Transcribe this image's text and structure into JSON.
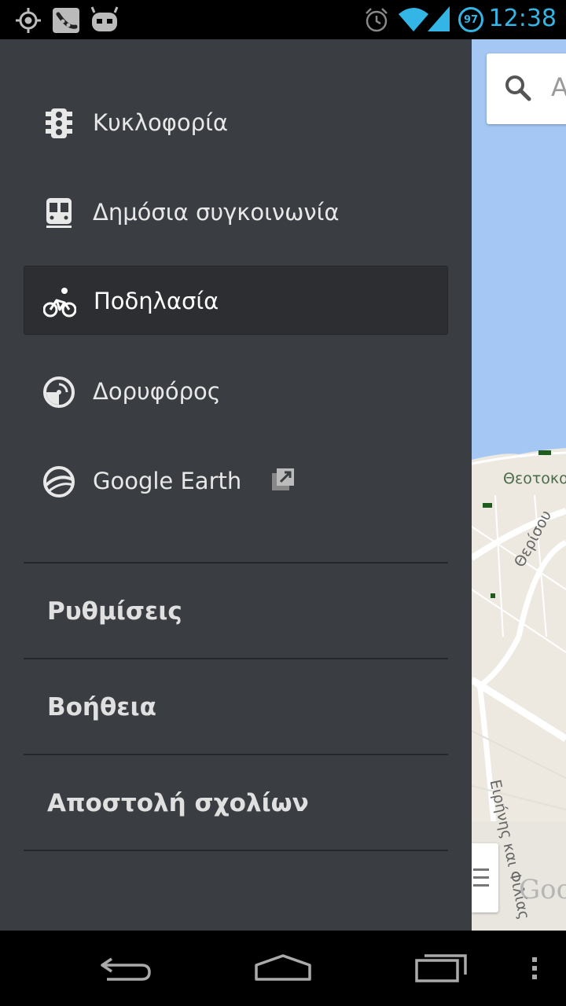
{
  "status_bar": {
    "time": "12:38",
    "battery_level": "97",
    "icons": [
      "location-icon",
      "pea-icon",
      "android-icon",
      "alarm-icon",
      "wifi-icon",
      "signal-icon",
      "battery-icon"
    ]
  },
  "map": {
    "search_hint": "A",
    "labels": {
      "theotokou": "Θεοτοκο",
      "therisou": "Θερίσου",
      "eirinis": "Ειρήνης και Φιλίας"
    },
    "watermark": "Goog"
  },
  "drawer": {
    "layers": [
      {
        "label": "Κυκλοφορία",
        "icon": "traffic-light-icon",
        "selected": false
      },
      {
        "label": "Δημόσια συγκοινωνία",
        "icon": "transit-icon",
        "selected": false
      },
      {
        "label": "Ποδηλασία",
        "icon": "bicycle-icon",
        "selected": true
      },
      {
        "label": "Δορυφόρος",
        "icon": "satellite-icon",
        "selected": false
      },
      {
        "label": "Google Earth",
        "icon": "google-earth-icon",
        "selected": false,
        "external": true
      }
    ],
    "menu": [
      {
        "label": "Ρυθμίσεις"
      },
      {
        "label": "Βοήθεια"
      },
      {
        "label": "Αποστολή σχολίων"
      }
    ]
  },
  "nav_bar": {
    "buttons": [
      "back-button",
      "home-button",
      "recents-button",
      "overflow-menu-button"
    ]
  },
  "colors": {
    "drawer_bg": "#3a3d41",
    "selected_bg": "#2c2e31",
    "status_accent": "#33b5e5",
    "sea": "#a5c7f4",
    "land": "#ede9e1"
  }
}
